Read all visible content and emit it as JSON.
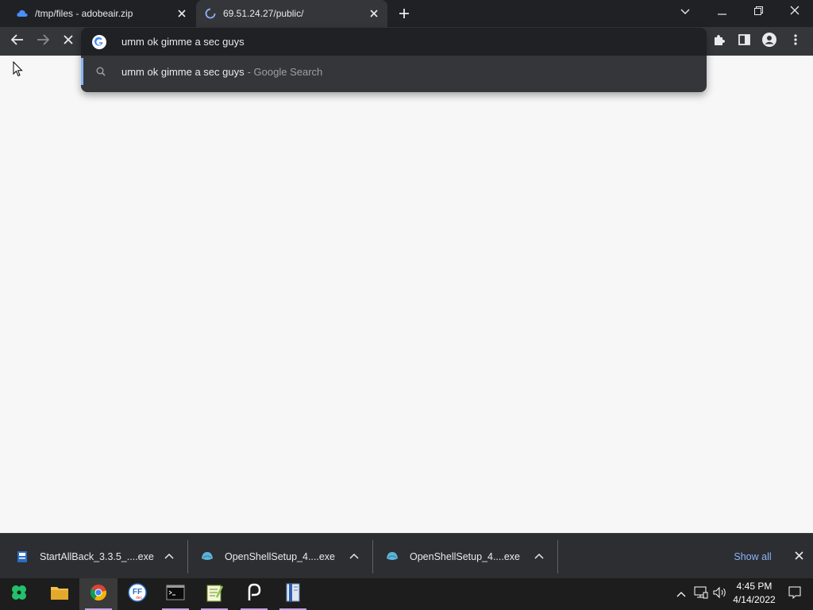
{
  "browser": {
    "tabs": [
      {
        "title": "/tmp/files - adobeair.zip",
        "active": false,
        "favicon": "cloud-icon"
      },
      {
        "title": "69.51.24.27/public/",
        "active": true,
        "favicon": "loading-spinner-icon"
      }
    ],
    "omnibox": {
      "text": "umm ok gimme a sec guys",
      "suggestion_text": "umm ok gimme a sec guys",
      "suggestion_meta": "- Google Search"
    }
  },
  "downloads": {
    "items": [
      {
        "name": "StartAllBack_3.3.5_....exe",
        "icon": "installer-icon"
      },
      {
        "name": "OpenShellSetup_4....exe",
        "icon": "shell-icon"
      },
      {
        "name": "OpenShellSetup_4....exe",
        "icon": "shell-icon"
      }
    ],
    "show_all": "Show all"
  },
  "taskbar": {
    "apps": [
      "clover-start-icon",
      "file-explorer-icon",
      "chrome-icon",
      "ff-dec-icon",
      "terminal-icon",
      "notepad-plus-icon",
      "p-app-icon",
      "book-app-icon"
    ],
    "clock": {
      "time": "4:45 PM",
      "date": "4/14/2022"
    }
  },
  "colors": {
    "accent": "#8ab4f8",
    "tab_bg": "#202124",
    "toolbar_bg": "#35363a",
    "taskbar_bg": "#1d1d1d"
  }
}
